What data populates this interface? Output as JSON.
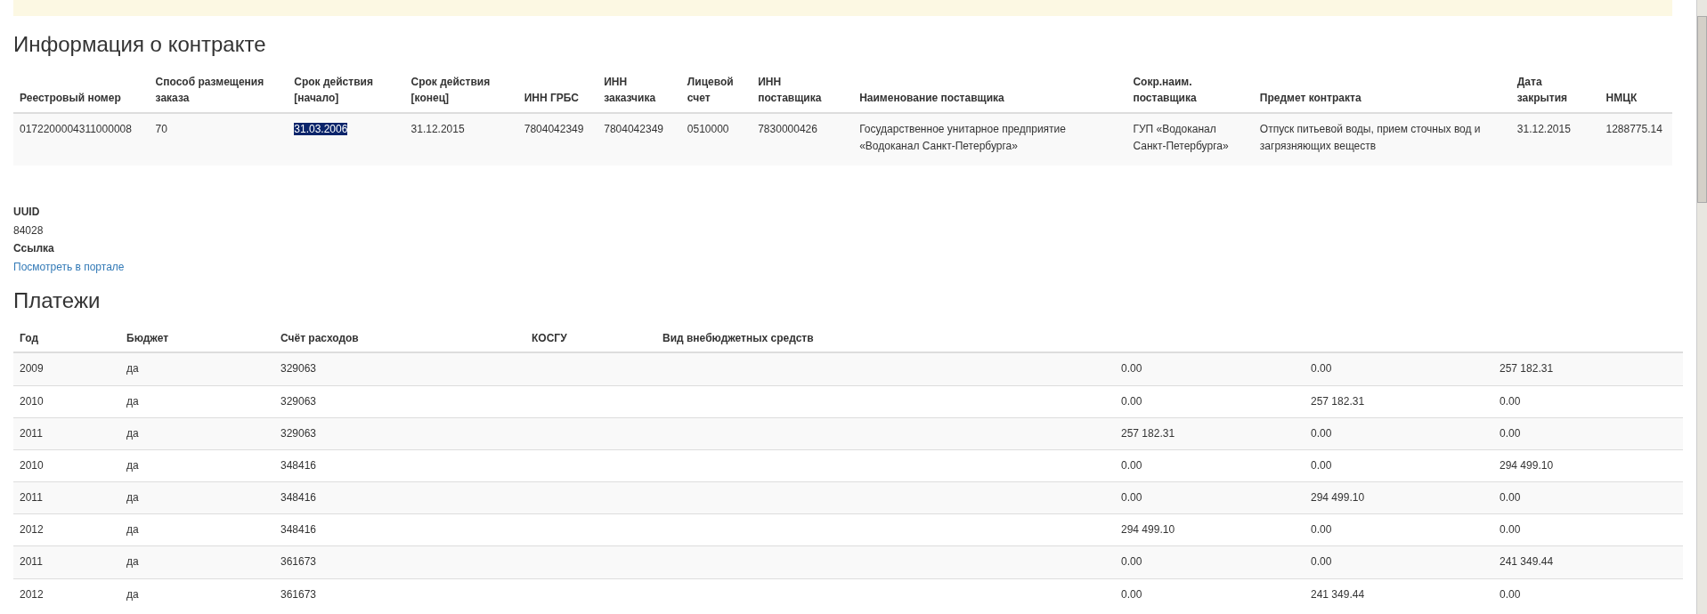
{
  "contract": {
    "title": "Информация о контракте",
    "columns": [
      "Реестровый номер",
      "Способ размещения заказа",
      "Срок действия [начало]",
      "Срок действия [конец]",
      "ИНН ГРБС",
      "ИНН заказчика",
      "Лицевой счет",
      "ИНН поставщика",
      "Наименование поставщика",
      "Сокр.наим. поставщика",
      "Предмет контракта",
      "Дата закрытия",
      "НМЦК"
    ],
    "rows": [
      {
        "cells": [
          {
            "text": "0172200004311000008",
            "selected": false
          },
          {
            "text": "70",
            "selected": false
          },
          {
            "text": "31.03.2006",
            "selected": true
          },
          {
            "text": "31.12.2015",
            "selected": false
          },
          {
            "text": "7804042349",
            "selected": false
          },
          {
            "text": "7804042349",
            "selected": false
          },
          {
            "text": "0510000",
            "selected": false
          },
          {
            "text": "7830000426",
            "selected": false
          },
          {
            "text": "Государственное унитарное предприятие «Водоканал Санкт-Петербурга»",
            "selected": false
          },
          {
            "text": "ГУП «Водоканал Санкт-Петербурга»",
            "selected": false
          },
          {
            "text": "Отпуск питьевой воды, прием сточных вод и загрязняющих веществ",
            "selected": false
          },
          {
            "text": "31.12.2015",
            "selected": false
          },
          {
            "text": "1288775.14",
            "selected": false
          }
        ]
      }
    ]
  },
  "details": [
    {
      "label": "UUID",
      "value": "84028",
      "kind": "text"
    },
    {
      "label": "Ссылка",
      "value": "Посмотреть в портале",
      "kind": "link"
    }
  ],
  "payments": {
    "title": "Платежи",
    "columns": [
      "Год",
      "Бюджет",
      "Счёт расходов",
      "КОСГУ",
      "Вид внебюджетных средств"
    ],
    "rows": [
      {
        "year": "2009",
        "budget": "да",
        "account": "329063",
        "column_6": "0.00",
        "column_7": "0.00",
        "column_8": "257 182.31"
      },
      {
        "year": "2010",
        "budget": "да",
        "account": "329063",
        "column_6": "0.00",
        "column_7": "257 182.31",
        "column_8": "0.00"
      },
      {
        "year": "2011",
        "budget": "да",
        "account": "329063",
        "column_6": "257 182.31",
        "column_7": "0.00",
        "column_8": "0.00"
      },
      {
        "year": "2010",
        "budget": "да",
        "account": "348416",
        "column_6": "0.00",
        "column_7": "0.00",
        "column_8": "294 499.10"
      },
      {
        "year": "2011",
        "budget": "да",
        "account": "348416",
        "column_6": "0.00",
        "column_7": "294 499.10",
        "column_8": "0.00"
      },
      {
        "year": "2012",
        "budget": "да",
        "account": "348416",
        "column_6": "294 499.10",
        "column_7": "0.00",
        "column_8": "0.00"
      },
      {
        "year": "2011",
        "budget": "да",
        "account": "361673",
        "column_6": "0.00",
        "column_7": "0.00",
        "column_8": "241 349.44"
      },
      {
        "year": "2012",
        "budget": "да",
        "account": "361673",
        "column_6": "0.00",
        "column_7": "241 349.44",
        "column_8": "0.00"
      }
    ]
  }
}
